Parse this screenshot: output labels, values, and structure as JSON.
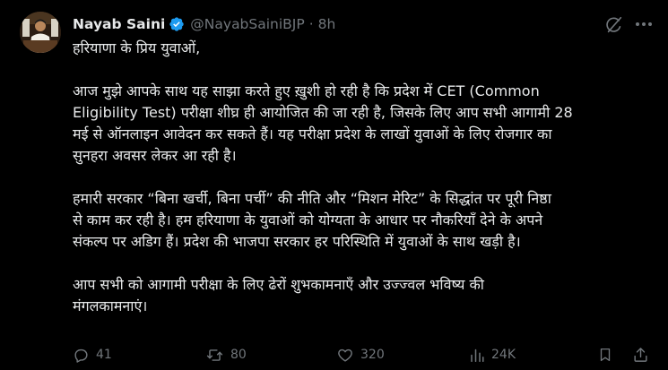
{
  "tweet": {
    "author_name": "Nayab Saini",
    "handle": "@NayabSainiBJP",
    "separator": "·",
    "time": "8h",
    "paragraphs": [
      [
        "हरियाणा के प्रिय युवाओं,"
      ],
      [
        "आज मुझे आपके साथ यह साझा करते हुए ख़ुशी हो रही है कि प्रदेश में CET (Common",
        "Eligibility Test) परीक्षा शीघ्र ही आयोजित की जा रही है, जिसके लिए आप सभी आगामी 28",
        "मई से ऑनलाइन आवेदन कर सकते हैं। यह परीक्षा प्रदेश के लाखों युवाओं के लिए रोजगार का",
        "सुनहरा अवसर लेकर आ रही है।"
      ],
      [
        "हमारी सरकार “बिना खर्ची, बिना पर्ची” की नीति और “मिशन मेरिट” के सिद्धांत पर पूरी निष्ठा",
        "से काम कर रही है। हम हरियाणा के युवाओं को योग्यता के आधार पर नौकरियाँ देने के अपने",
        "संकल्प पर अडिग हैं। प्रदेश की भाजपा सरकार हर परिस्थिति में युवाओं के साथ खड़ी है।"
      ],
      [
        "आप सभी को आगामी परीक्षा के लिए ढेरों शुभकामनाएँ और उज्ज्वल भविष्य की",
        "मंगलकामनाएं।"
      ]
    ],
    "stats": {
      "replies": "41",
      "reposts": "80",
      "likes": "320",
      "views": "24K"
    }
  },
  "colors": {
    "background": "#000000",
    "text": "#e7e9ea",
    "muted": "#71767b",
    "verified": "#1d9bf0"
  }
}
